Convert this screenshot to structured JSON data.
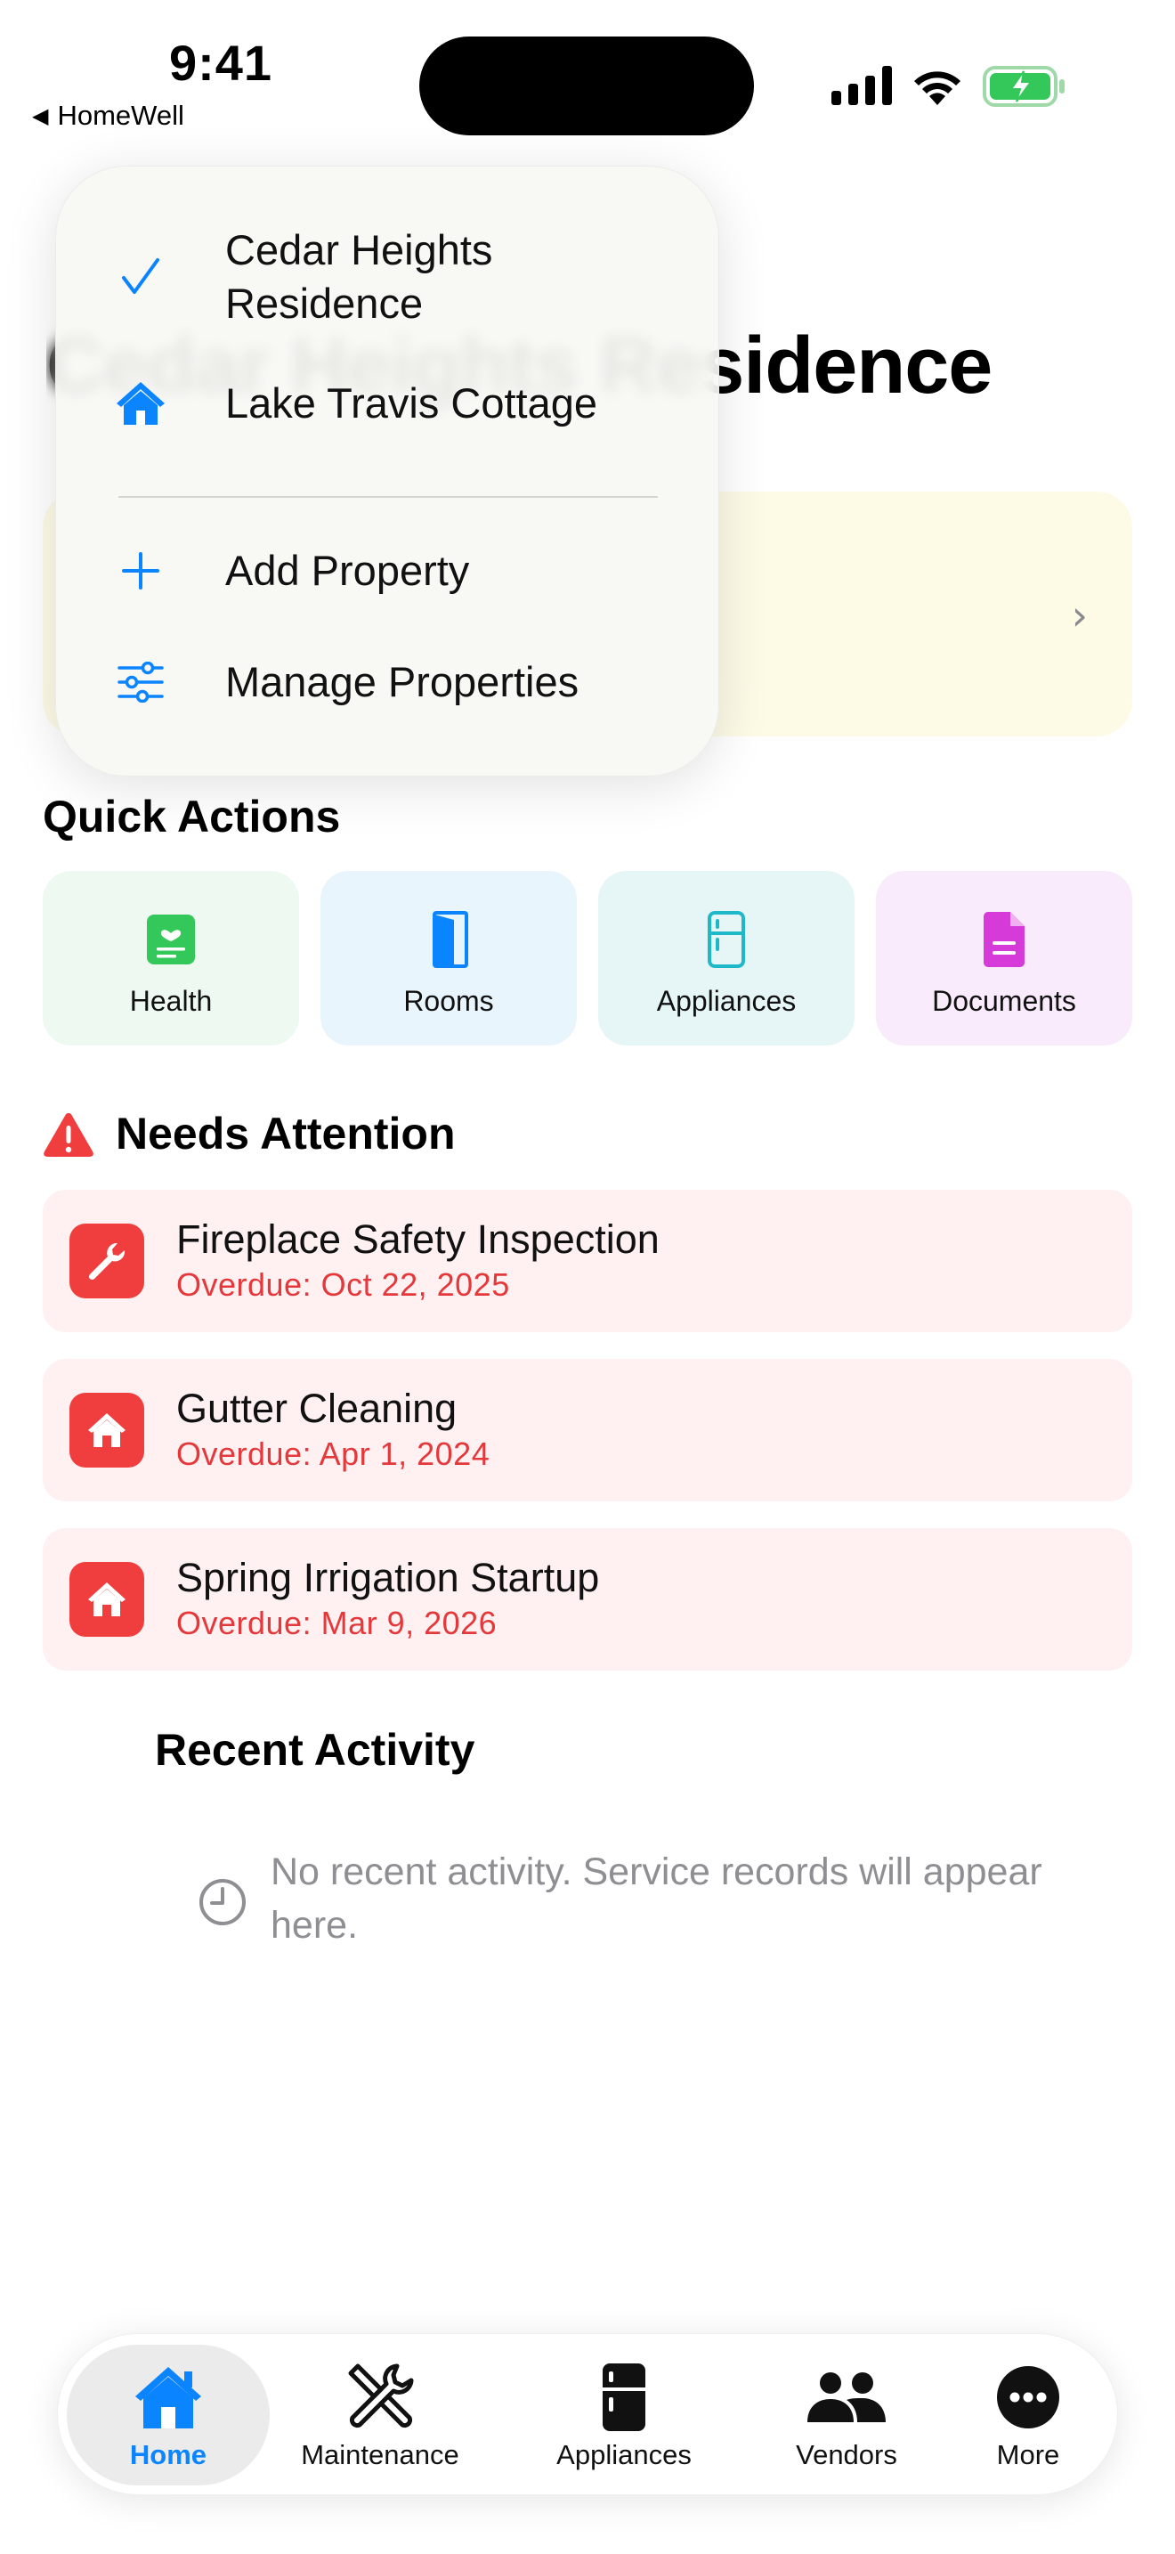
{
  "status_bar": {
    "time": "9:41",
    "back_label": "HomeWell"
  },
  "page": {
    "title": "Cedar Heights Residence"
  },
  "property_menu": {
    "items": [
      {
        "label": "Cedar Heights Residence",
        "icon": "checkmark-icon",
        "selected": true
      },
      {
        "label": "Lake Travis Cottage",
        "icon": "house-icon",
        "selected": false
      }
    ],
    "actions": [
      {
        "label": "Add Property",
        "icon": "plus-icon"
      },
      {
        "label": "Manage Properties",
        "icon": "sliders-icon"
      }
    ]
  },
  "quick_actions": {
    "title": "Quick Actions",
    "items": [
      {
        "label": "Health",
        "icon": "health-icon",
        "color": "#34c759",
        "bg": "#eefaf1"
      },
      {
        "label": "Rooms",
        "icon": "door-icon",
        "color": "#0a84ff",
        "bg": "#e8f5fd"
      },
      {
        "label": "Appliances",
        "icon": "refrigerator-icon",
        "color": "#1fb8c9",
        "bg": "#e6f6f7"
      },
      {
        "label": "Documents",
        "icon": "document-icon",
        "color": "#d63ad9",
        "bg": "#f9ebfb"
      }
    ]
  },
  "needs_attention": {
    "title": "Needs Attention",
    "items": [
      {
        "title": "Fireplace Safety Inspection",
        "subtitle": "Overdue: Oct 22, 2025",
        "icon": "wrench-icon"
      },
      {
        "title": "Gutter Cleaning",
        "subtitle": "Overdue: Apr 1, 2024",
        "icon": "house-icon"
      },
      {
        "title": "Spring Irrigation Startup",
        "subtitle": "Overdue: Mar 9, 2026",
        "icon": "house-icon"
      }
    ]
  },
  "recent_activity": {
    "title": "Recent Activity",
    "empty_text": "No recent activity. Service records will appear here."
  },
  "tab_bar": {
    "tabs": [
      {
        "label": "Home",
        "icon": "house-icon",
        "active": true
      },
      {
        "label": "Maintenance",
        "icon": "tools-icon",
        "active": false
      },
      {
        "label": "Appliances",
        "icon": "refrigerator-icon",
        "active": false
      },
      {
        "label": "Vendors",
        "icon": "people-icon",
        "active": false
      },
      {
        "label": "More",
        "icon": "ellipsis-icon",
        "active": false
      }
    ],
    "accent_color": "#0a84ff"
  }
}
